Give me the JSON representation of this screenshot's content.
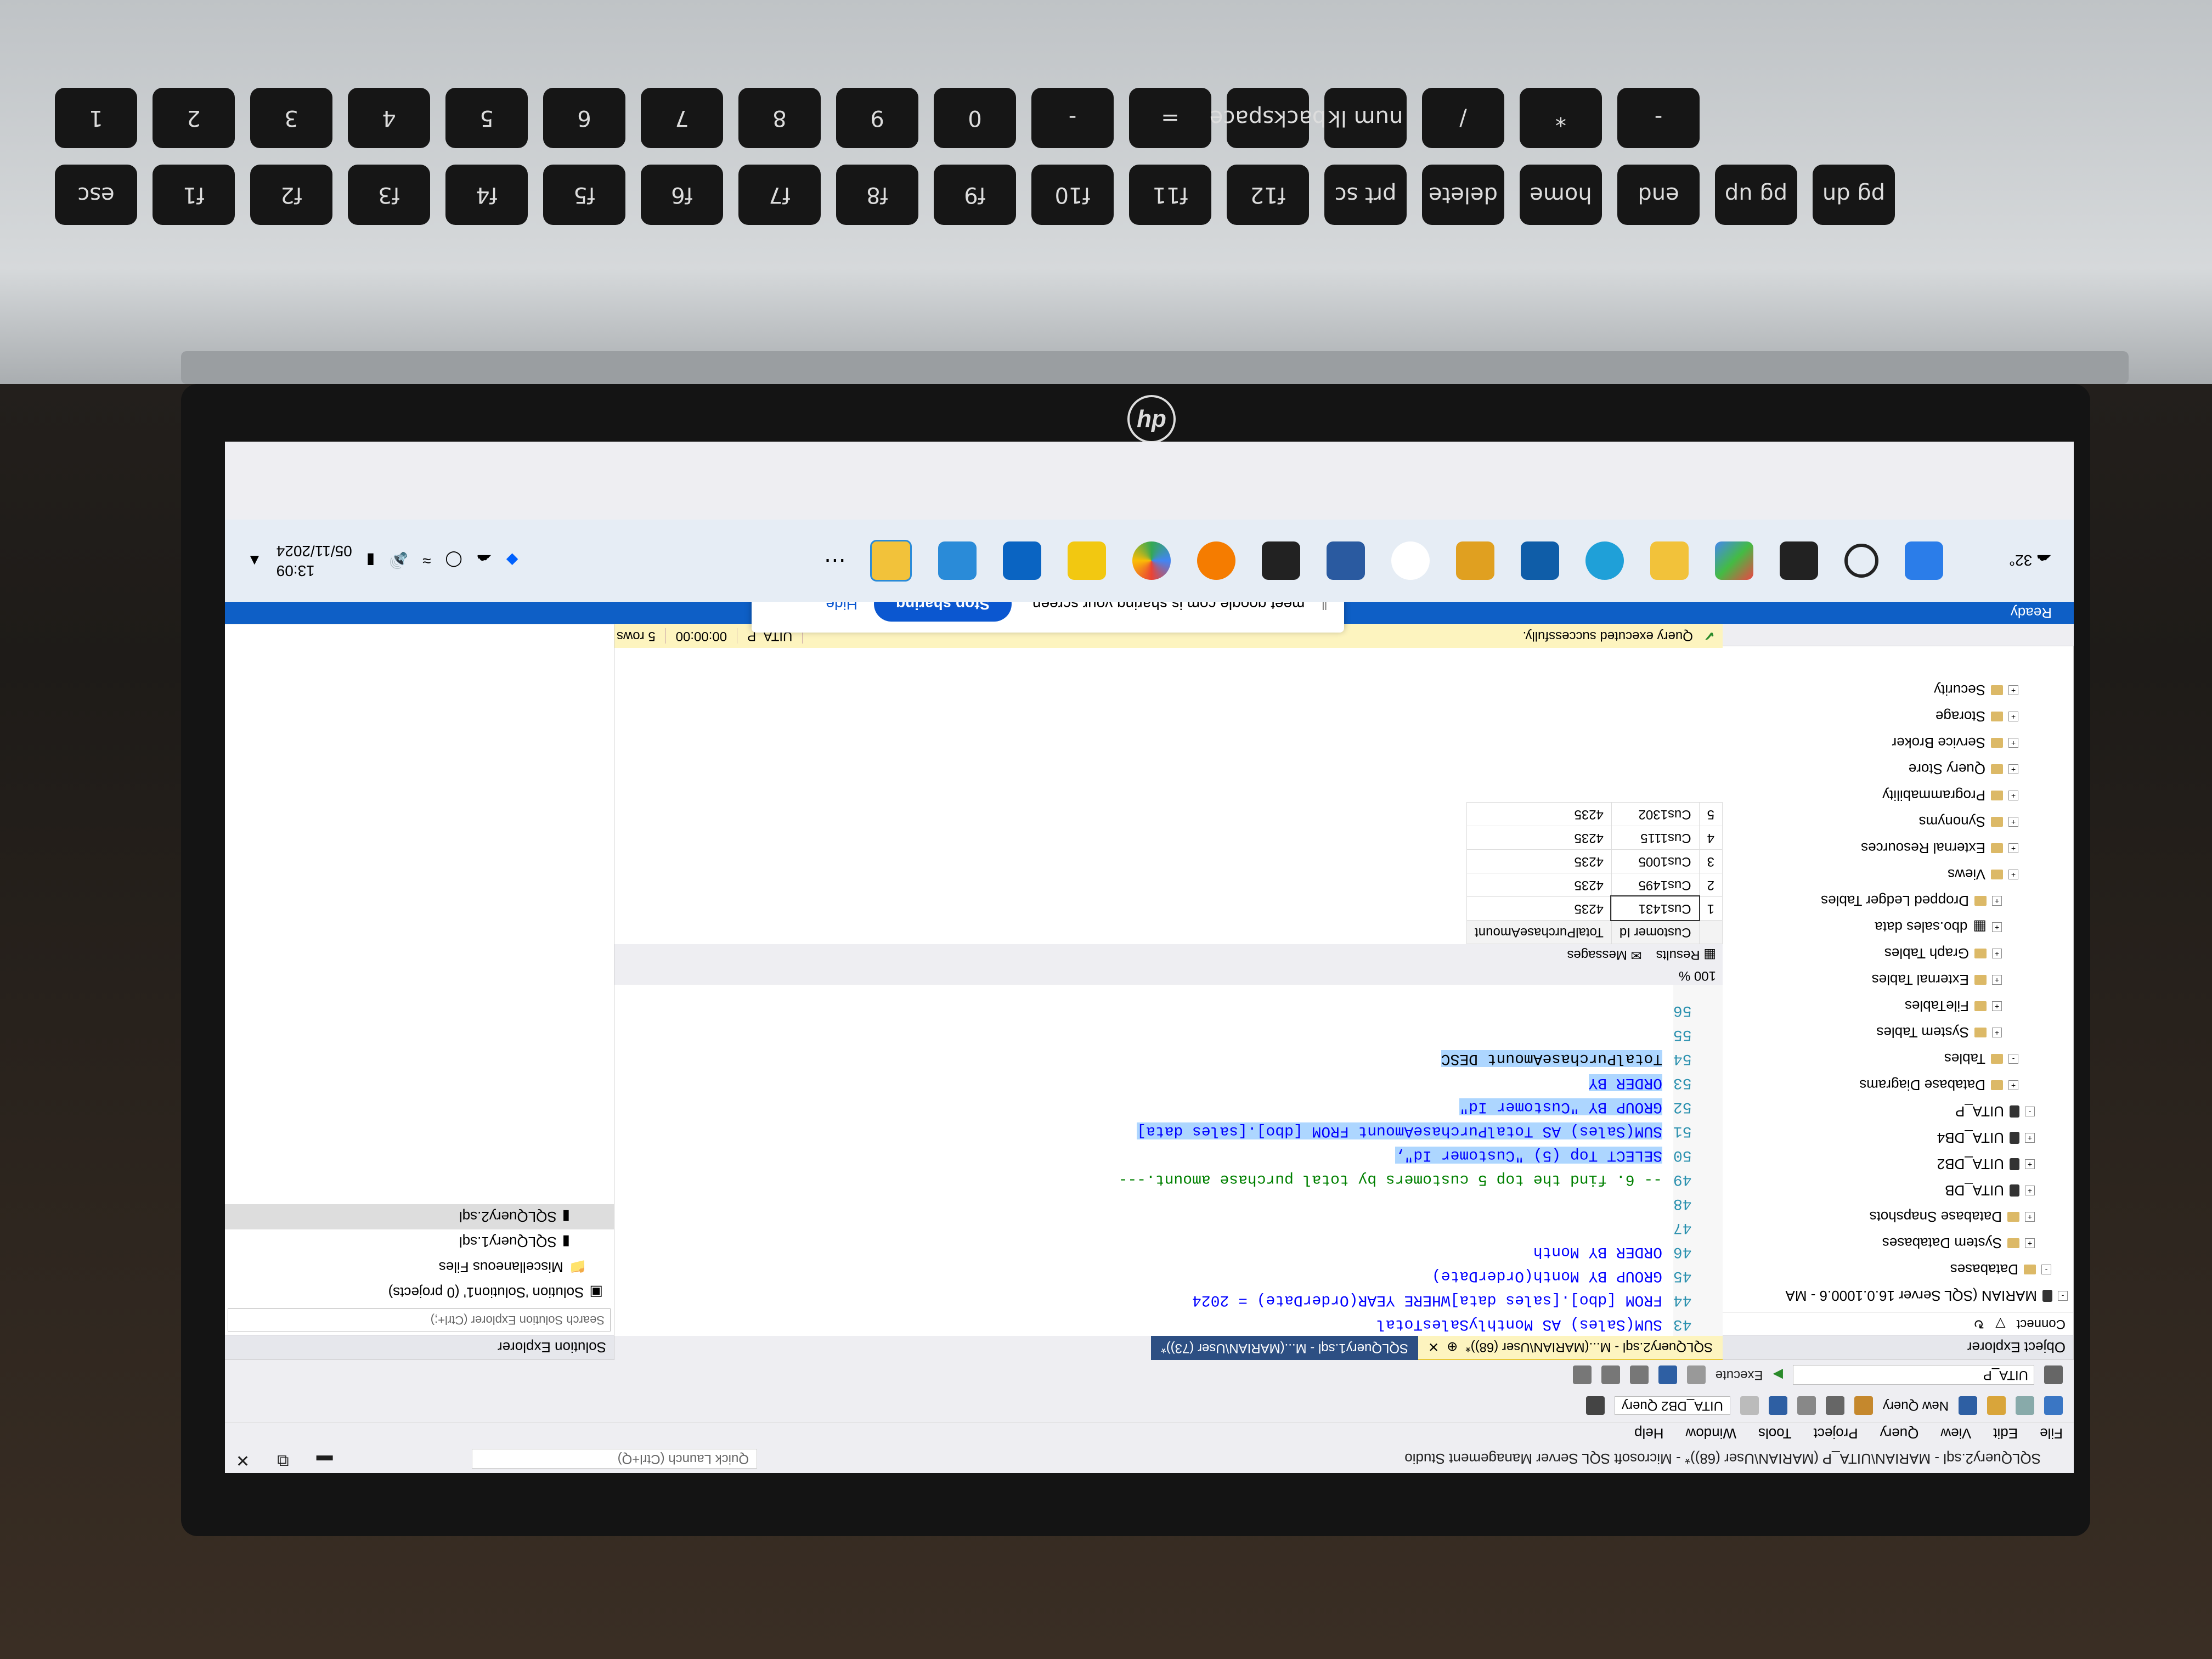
{
  "window": {
    "title": "SQLQuery2.sql - MARIAN\\UITA_P (MARIAN\\User (68))* - Microsoft SQL Server Management Studio",
    "quick_launch": "Quick Launch (Ctrl+Q)"
  },
  "menu": [
    "File",
    "Edit",
    "View",
    "Query",
    "Project",
    "Tools",
    "Window",
    "Help"
  ],
  "toolbar": {
    "new_query": "New Query",
    "database_combo": "UITA_DB2 Query",
    "current_db": "UITA_P",
    "execute": "Execute"
  },
  "object_explorer": {
    "title": "Object Explorer",
    "connect": "Connect",
    "items": [
      "MARIAN (SQL Server 16.0.1000.6 - MA",
      "Databases",
      "System Databases",
      "Database Snapshots",
      "UITA_DB",
      "UITA_DB2",
      "UITA_DB4",
      "UITA_P",
      "Database Diagrams",
      "Tables",
      "System Tables",
      "FileTables",
      "External Tables",
      "Graph Tables",
      "dbo.sales data",
      "Dropped Ledger Tables",
      "Views",
      "External Resources",
      "Synonyms",
      "Programmability",
      "Query Store",
      "Service Broker",
      "Storage",
      "Security"
    ]
  },
  "tabs": [
    {
      "label": "SQLQuery2.sql - M...(MARIAN\\User (68))*"
    },
    {
      "label": "SQLQuery1.sql - M...(MARIAN\\User (73))*"
    }
  ],
  "editor": {
    "lines": [
      {
        "n": "43",
        "t": "SUM(Sales) AS MonthlySalesTotal"
      },
      {
        "n": "44",
        "t": "FROM [dbo].[sales data]WHERE YEAR(OrderDate) = 2024"
      },
      {
        "n": "45",
        "t": "GROUP BY Month(OrderDate)"
      },
      {
        "n": "46",
        "t": "ORDER BY Month"
      },
      {
        "n": "47",
        "t": ""
      },
      {
        "n": "48",
        "t": ""
      },
      {
        "n": "49",
        "t": "-- 6. find the top 5 customers by total purchase amount.---"
      },
      {
        "n": "50",
        "t": "SELECT Top (5) \"Customer Id\","
      },
      {
        "n": "51",
        "t": "SUM(Sales) AS TotalPurchaseAmount FROM [dbo].[sales data]"
      },
      {
        "n": "52",
        "t": "GROUP BY \"Customer Id\""
      },
      {
        "n": "53",
        "t": "ORDER BY"
      },
      {
        "n": "54",
        "t": "TotalPurchaseAmount DESC"
      },
      {
        "n": "55",
        "t": ""
      },
      {
        "n": "56",
        "t": ""
      }
    ]
  },
  "zoom": "100 %",
  "results_tabs": {
    "results": "Results",
    "messages": "Messages"
  },
  "results": {
    "columns": [
      "",
      "Customer Id",
      "TotalPurchaseAmount"
    ],
    "rows": [
      [
        "1",
        "Cus1431",
        "4235"
      ],
      [
        "2",
        "Cus1495",
        "4235"
      ],
      [
        "3",
        "Cus1005",
        "4235"
      ],
      [
        "4",
        "Cus1115",
        "4235"
      ],
      [
        "5",
        "Cus1302",
        "4235"
      ]
    ]
  },
  "status": {
    "message": "Query executed successfully.",
    "db": "UITA_P",
    "time": "00:00:00",
    "rows": "5 rows"
  },
  "solution_explorer": {
    "title": "Solution Explorer",
    "search": "Search Solution Explorer (Ctrl+;)",
    "items": [
      "Solution 'Solution1' (0 projects)",
      "Miscellaneous Files",
      "SQLQuery1.sql",
      "SQLQuery2.sql"
    ]
  },
  "ready": "Ready",
  "share_banner": {
    "text": "meet.google.com is sharing your screen.",
    "stop": "Stop sharing",
    "hide": "Hide"
  },
  "taskbar": {
    "weather": "32°",
    "time": "13:09",
    "date": "05/11/2024"
  },
  "keyboard": {
    "row1": [
      "esc",
      "f1",
      "f2",
      "f3",
      "f4",
      "f5",
      "f6",
      "f7",
      "f8",
      "f9",
      "f10",
      "f11",
      "f12",
      "prt sc",
      "delete",
      "home",
      "end",
      "pg up",
      "pg dn"
    ],
    "row2": [
      "1",
      "2",
      "3",
      "4",
      "5",
      "6",
      "7",
      "8",
      "9",
      "0",
      "-",
      "=",
      "backspace",
      "num lk",
      "/",
      "*",
      "-"
    ]
  }
}
